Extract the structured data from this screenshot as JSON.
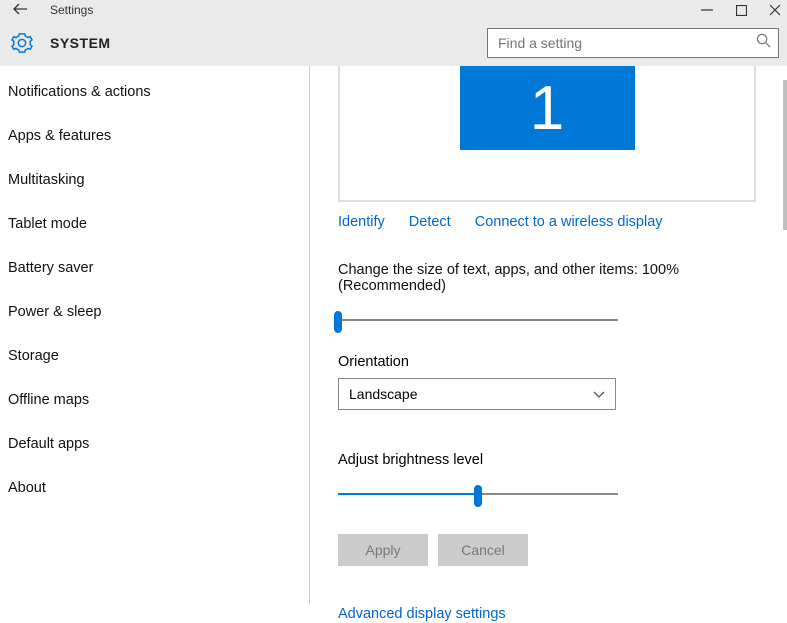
{
  "titlebar": {
    "title": "Settings"
  },
  "header": {
    "section": "SYSTEM"
  },
  "search": {
    "placeholder": "Find a setting"
  },
  "sidebar": {
    "items": [
      "Notifications & actions",
      "Apps & features",
      "Multitasking",
      "Tablet mode",
      "Battery saver",
      "Power & sleep",
      "Storage",
      "Offline maps",
      "Default apps",
      "About"
    ]
  },
  "display": {
    "monitor_number": "1",
    "identify": "Identify",
    "detect": "Detect",
    "connect_wireless": "Connect to a wireless display",
    "scale_label": "Change the size of text, apps, and other items: 100% (Recommended)",
    "scale_value_pct": 0,
    "orientation_label": "Orientation",
    "orientation_value": "Landscape",
    "brightness_label": "Adjust brightness level",
    "brightness_value_pct": 50,
    "apply": "Apply",
    "cancel": "Cancel",
    "advanced": "Advanced display settings"
  }
}
